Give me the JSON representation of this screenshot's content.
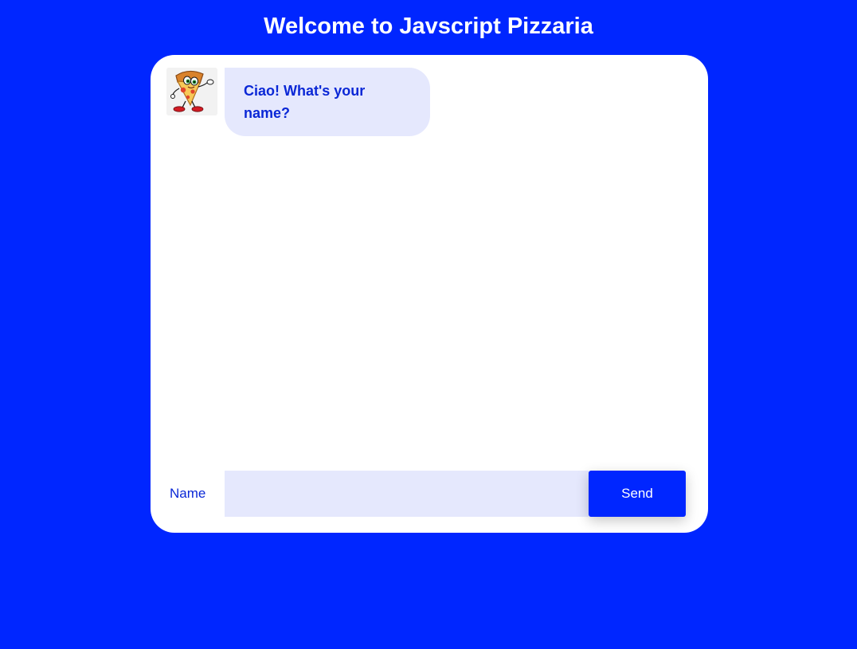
{
  "header": {
    "title": "Welcome to Javscript Pizzaria"
  },
  "chat": {
    "messages": [
      {
        "sender": "bot",
        "avatar_icon": "pizza-mascot-icon",
        "text": "Ciao! What's your name?"
      }
    ]
  },
  "form": {
    "label": "Name",
    "input_value": "",
    "send_label": "Send"
  },
  "colors": {
    "background": "#0026ff",
    "card": "#ffffff",
    "bubble": "#e5e8fd",
    "text_accent": "#0a27d6",
    "button": "#0026ff"
  }
}
